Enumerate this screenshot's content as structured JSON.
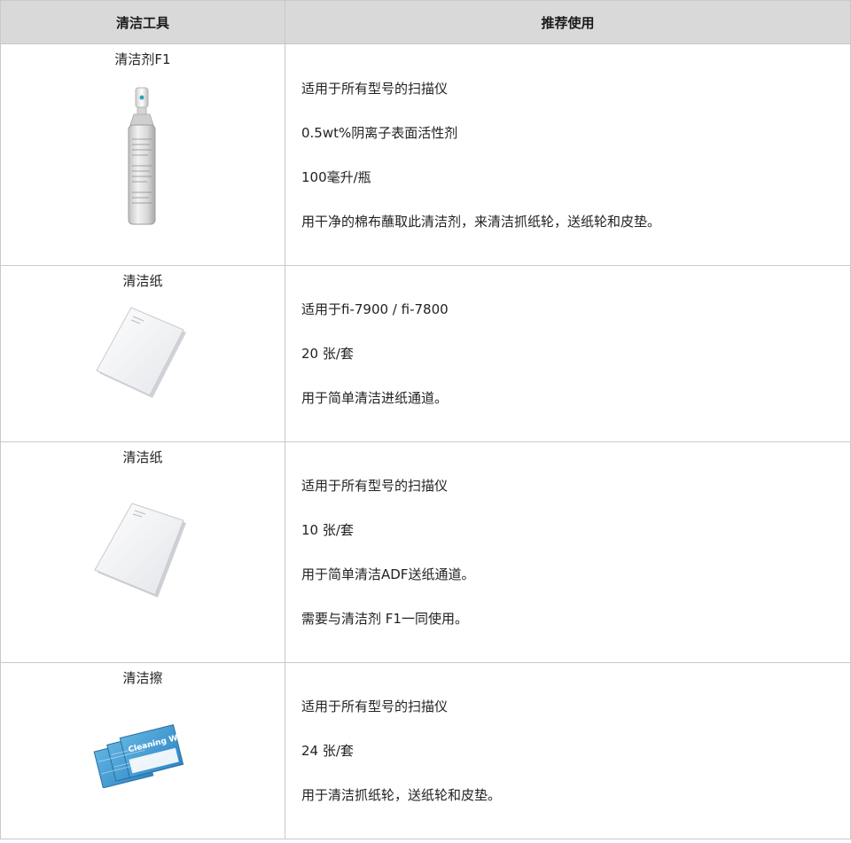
{
  "header": {
    "col1": "清洁工具",
    "col2": "推荐使用"
  },
  "rows": [
    {
      "tool": "清洁剂F1",
      "image": "spray-bottle-icon",
      "lines": [
        "适用于所有型号的扫描仪",
        "0.5wt%阴离子表面活性剂",
        "100毫升/瓶",
        "用干净的棉布蘸取此清洁剂，来清洁抓纸轮，送纸轮和皮垫。"
      ]
    },
    {
      "tool": "清洁纸",
      "image": "cleaning-paper-icon",
      "lines": [
        "适用于fi-7900 / fi-7800",
        "20 张/套",
        "用于简单清洁进纸通道。"
      ]
    },
    {
      "tool": "清洁纸",
      "image": "cleaning-paper-icon",
      "lines": [
        "适用于所有型号的扫描仪",
        "10 张/套",
        "用于简单清洁ADF送纸通道。",
        "需要与清洁剂 F1一同使用。"
      ]
    },
    {
      "tool": "清洁擦",
      "image": "cleaning-wipes-icon",
      "wipe_label": "Cleaning Wipe",
      "lines": [
        "适用于所有型号的扫描仪",
        "24 张/套",
        "用于清洁抓纸轮，送纸轮和皮垫。"
      ]
    }
  ]
}
